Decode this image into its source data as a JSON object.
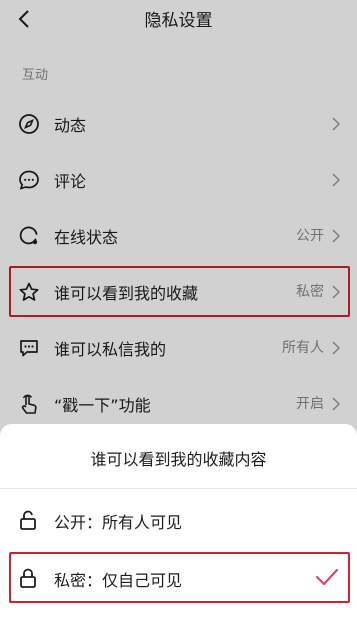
{
  "header": {
    "title": "隐私设置"
  },
  "section": {
    "label": "互动"
  },
  "rows": [
    {
      "label": "动态",
      "value": ""
    },
    {
      "label": "评论",
      "value": ""
    },
    {
      "label": "在线状态",
      "value": "公开"
    },
    {
      "label": "谁可以看到我的收藏",
      "value": "私密"
    },
    {
      "label": "谁可以私信我的",
      "value": "所有人"
    },
    {
      "label": "“戳一下”功能",
      "value": "开启"
    }
  ],
  "sheet": {
    "title": "谁可以看到我的收藏内容",
    "options": [
      {
        "label": "公开：所有人可见",
        "selected": false
      },
      {
        "label": "私密：仅自己可见",
        "selected": true
      }
    ]
  },
  "colors": {
    "highlight": "#c8252d",
    "check": "#d9446a",
    "secondary_text": "#8a8a8a"
  },
  "icons": [
    "back-icon",
    "compass-icon",
    "comment-icon",
    "online-status-icon",
    "star-icon",
    "message-icon",
    "poke-hand-icon",
    "unlock-icon",
    "lock-icon",
    "check-icon",
    "chevron-right-icon"
  ]
}
